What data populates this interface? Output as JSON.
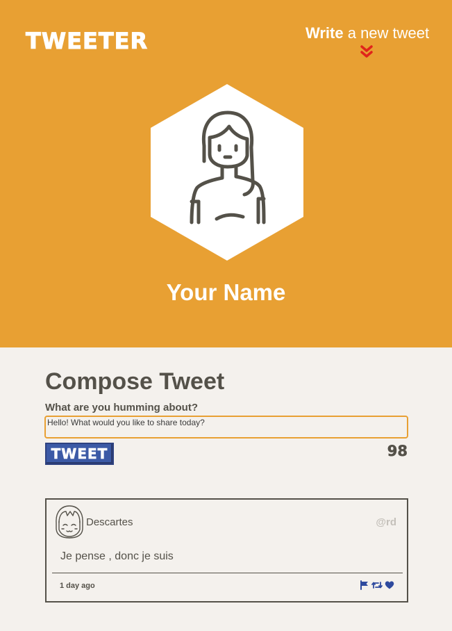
{
  "header": {
    "logo": "TWEETER",
    "write_link_bold": "Write",
    "write_link_rest": " a new tweet",
    "profile_name": "Your Name",
    "background_color": "#e8a033"
  },
  "compose": {
    "title": "Compose Tweet",
    "label": "What are you humming about?",
    "input_value": "Hello! What would you like to share today?",
    "tweet_button": "TWEET",
    "char_counter": "98"
  },
  "tweets": [
    {
      "author": "Descartes",
      "handle": "@rd",
      "text": "Je pense , donc je suis",
      "timestamp": "1 day ago",
      "actions": [
        "flag-icon",
        "retweet-icon",
        "heart-icon"
      ]
    }
  ],
  "colors": {
    "accent": "#e8a033",
    "text": "#545149",
    "button": "#3c5aa6",
    "chevron": "#e0241b"
  }
}
